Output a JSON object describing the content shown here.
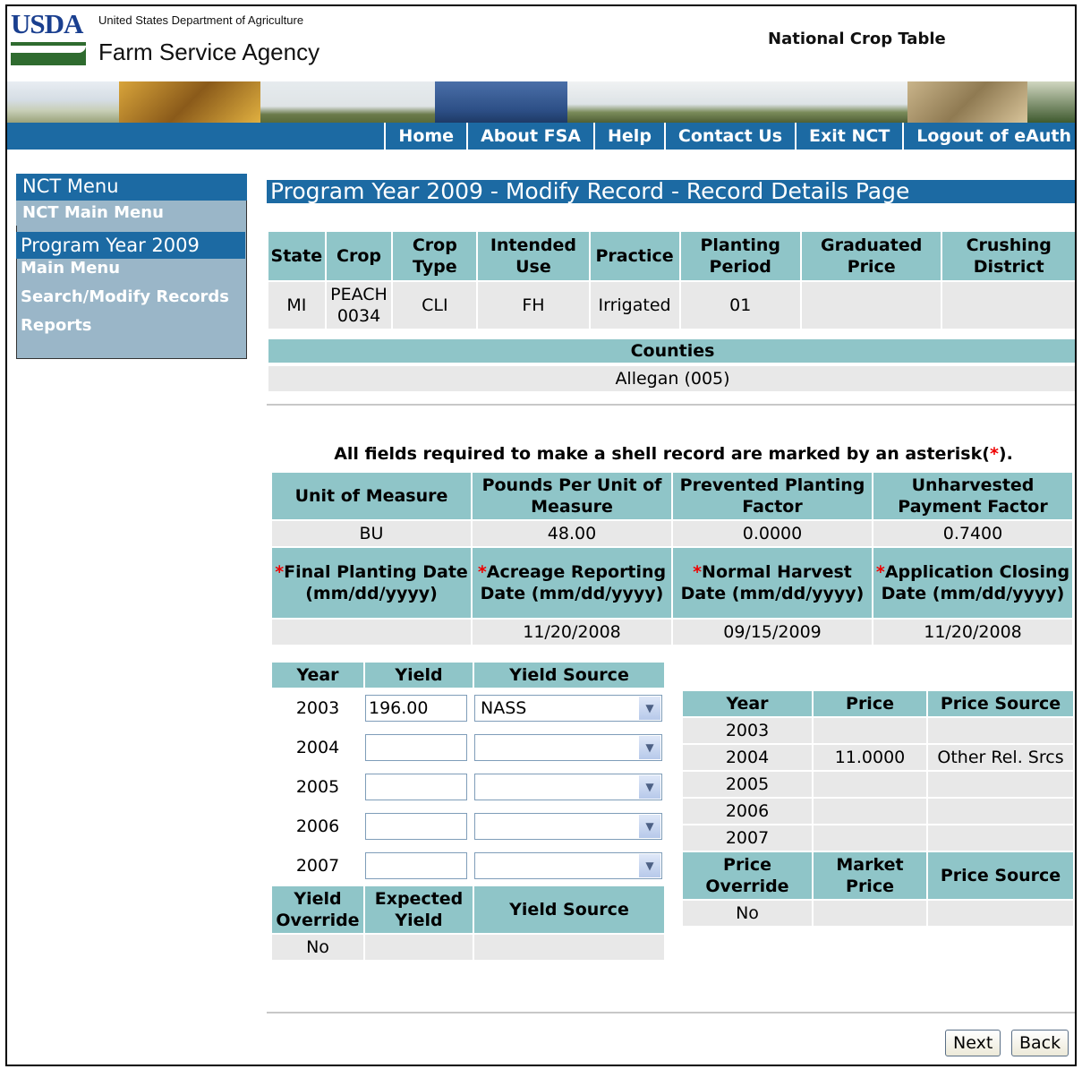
{
  "header": {
    "logo_text": "USDA",
    "department": "United States Department of Agriculture",
    "agency": "Farm Service Agency",
    "app_title": "National Crop Table"
  },
  "nav": [
    "Home",
    "About FSA",
    "Help",
    "Contact Us",
    "Exit NCT",
    "Logout of eAuth"
  ],
  "sidebar": {
    "title": "NCT Menu",
    "main_menu": "NCT Main Menu",
    "section": "Program Year 2009",
    "items": [
      "Main Menu",
      "Search/Modify Records",
      "Reports"
    ]
  },
  "page_title": "Program Year 2009 - Modify Record - Record Details Page",
  "record": {
    "headers": [
      "State",
      "Crop",
      "Crop Type",
      "Intended Use",
      "Practice",
      "Planting Period",
      "Graduated Price",
      "Crushing District"
    ],
    "values": [
      "MI",
      "PEACH 0034",
      "CLI",
      "FH",
      "Irrigated",
      "01",
      "",
      ""
    ]
  },
  "counties": {
    "label": "Counties",
    "value": "Allegan (005)"
  },
  "note": {
    "text": "All fields required to make a shell record are marked by an asterisk(",
    "asterisk": "*",
    "end": ")."
  },
  "measure": {
    "headers": [
      "Unit of Measure",
      "Pounds Per Unit of Measure",
      "Prevented Planting Factor",
      "Unharvested Payment Factor"
    ],
    "values": [
      "BU",
      "48.00",
      "0.0000",
      "0.7400"
    ],
    "date_headers": [
      "Final Planting Date (mm/dd/yyyy)",
      "Acreage Reporting Date (mm/dd/yyyy)",
      "Normal Harvest Date (mm/dd/yyyy)",
      "Application Closing Date (mm/dd/yyyy)"
    ],
    "date_values": [
      "",
      "11/20/2008",
      "09/15/2009",
      "11/20/2008"
    ]
  },
  "yield": {
    "headers": [
      "Year",
      "Yield",
      "Yield Source"
    ],
    "rows": [
      {
        "year": "2003",
        "yield": "196.00",
        "source": "NASS"
      },
      {
        "year": "2004",
        "yield": "",
        "source": ""
      },
      {
        "year": "2005",
        "yield": "",
        "source": ""
      },
      {
        "year": "2006",
        "yield": "",
        "source": ""
      },
      {
        "year": "2007",
        "yield": "",
        "source": ""
      }
    ],
    "override_headers": [
      "Yield Override",
      "Expected Yield",
      "Yield Source"
    ],
    "override_values": [
      "No",
      "",
      ""
    ]
  },
  "price": {
    "headers": [
      "Year",
      "Price",
      "Price Source"
    ],
    "rows": [
      {
        "year": "2003",
        "price": "",
        "source": ""
      },
      {
        "year": "2004",
        "price": "11.0000",
        "source": "Other Rel. Srcs"
      },
      {
        "year": "2005",
        "price": "",
        "source": ""
      },
      {
        "year": "2006",
        "price": "",
        "source": ""
      },
      {
        "year": "2007",
        "price": "",
        "source": ""
      }
    ],
    "override_headers": [
      "Price Override",
      "Market Price",
      "Price Source"
    ],
    "override_values": [
      "No",
      "",
      ""
    ]
  },
  "buttons": {
    "next": "Next",
    "back": "Back"
  }
}
